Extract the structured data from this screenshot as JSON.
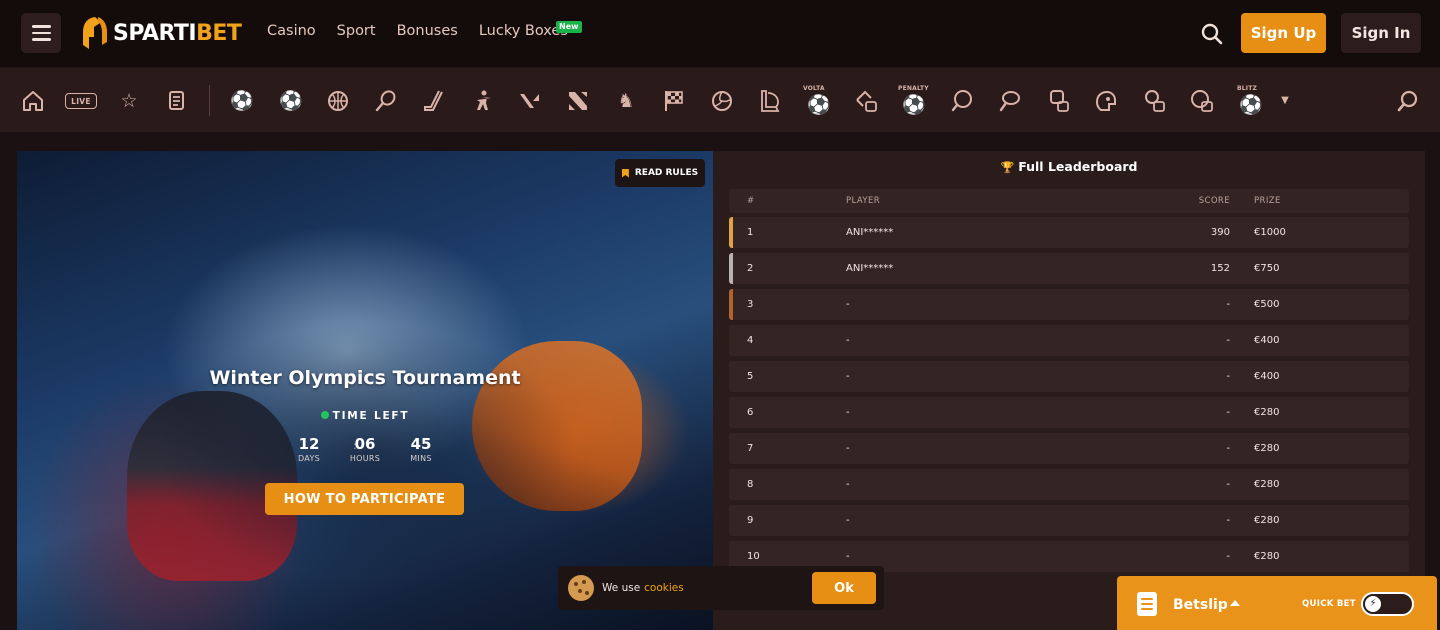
{
  "header": {
    "logo_text_a": "SPARTI",
    "logo_text_b": "BET",
    "nav": [
      "Casino",
      "Sport",
      "Bonuses",
      "Lucky Boxes"
    ],
    "new_badge": "New",
    "signup_label": "Sign Up",
    "signin_label": "Sign In"
  },
  "sports_bar": {
    "live_label": "LIVE",
    "volta_label": "VOLTA",
    "penalty_label": "PENALTY",
    "blitz_label": "BLITZ",
    "icons": [
      "home-icon",
      "live-icon",
      "star-icon",
      "betslip-list-icon",
      "soccer-icon",
      "esoccer-icon",
      "basketball-icon",
      "tennis-icon",
      "hockey-icon",
      "counter-strike-icon",
      "valorant-icon",
      "dota-icon",
      "chess-icon",
      "racing-flag-icon",
      "volleyball-icon",
      "league-of-legends-icon",
      "volta-icon",
      "ebasketball-icon",
      "penalty-icon",
      "table-tennis-icon",
      "badminton-icon",
      "boxing-icon",
      "american-football-icon",
      "etennis-icon",
      "basketball-blitz-icon",
      "blitz-icon"
    ]
  },
  "tournament": {
    "read_rules": "READ RULES",
    "title": "Winter Olympics Tournament",
    "time_left_label": "TIME LEFT",
    "countdown": [
      {
        "value": "12",
        "label": "DAYS"
      },
      {
        "value": "06",
        "label": "HOURS"
      },
      {
        "value": "45",
        "label": "MINS"
      }
    ],
    "participate_label": "HOW TO PARTICIPATE"
  },
  "leaderboard": {
    "title": "Full Leaderboard",
    "columns": [
      "#",
      "PLAYER",
      "SCORE",
      "PRIZE"
    ],
    "rows": [
      {
        "rank": "1",
        "player": "ANI******",
        "score": "390",
        "prize": "€1000",
        "accent": "#e0a045"
      },
      {
        "rank": "2",
        "player": "ANI******",
        "score": "152",
        "prize": "€750",
        "accent": "#b9b3b0"
      },
      {
        "rank": "3",
        "player": "-",
        "score": "-",
        "prize": "€500",
        "accent": "#b3622d"
      },
      {
        "rank": "4",
        "player": "-",
        "score": "-",
        "prize": "€400",
        "accent": ""
      },
      {
        "rank": "5",
        "player": "-",
        "score": "-",
        "prize": "€400",
        "accent": ""
      },
      {
        "rank": "6",
        "player": "-",
        "score": "-",
        "prize": "€280",
        "accent": ""
      },
      {
        "rank": "7",
        "player": "-",
        "score": "-",
        "prize": "€280",
        "accent": ""
      },
      {
        "rank": "8",
        "player": "-",
        "score": "-",
        "prize": "€280",
        "accent": ""
      },
      {
        "rank": "9",
        "player": "-",
        "score": "-",
        "prize": "€280",
        "accent": ""
      },
      {
        "rank": "10",
        "player": "-",
        "score": "-",
        "prize": "€280",
        "accent": ""
      }
    ]
  },
  "cookie": {
    "text": "We use",
    "link": "cookies",
    "ok_label": "Ok"
  },
  "betslip": {
    "label": "Betslip",
    "quick_bet_label": "QUICK BET"
  },
  "colors": {
    "accent": "#e68f14",
    "background": "#1b1112",
    "new_badge": "#19b34a"
  }
}
